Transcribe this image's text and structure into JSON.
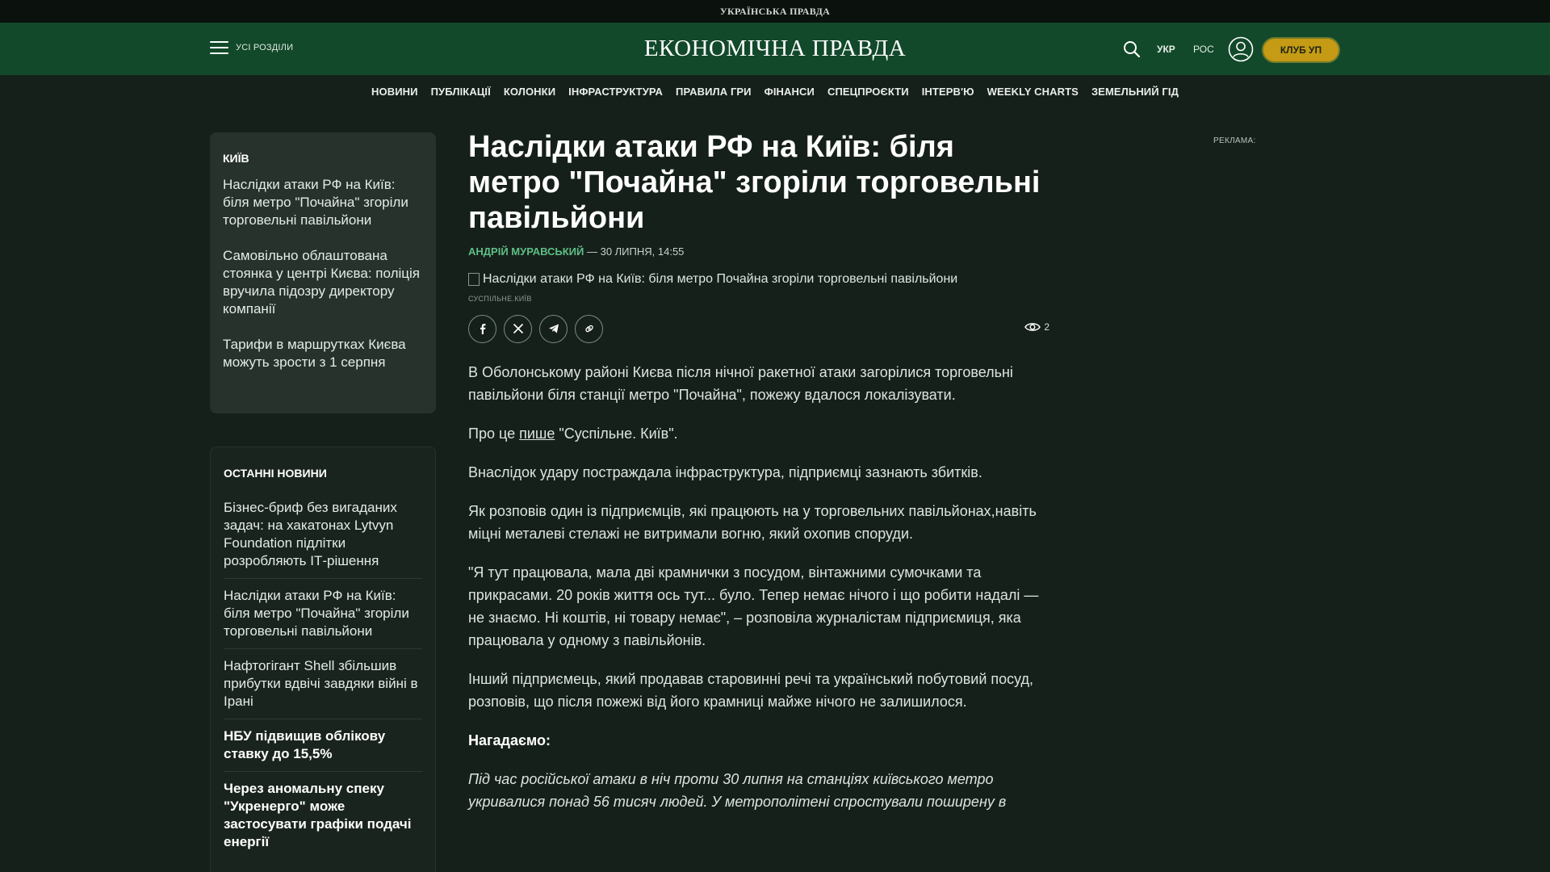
{
  "topstrip": {
    "brand": "УКРАЇНСЬКА ПРАВДА"
  },
  "header": {
    "menu_label": "УСІ РОЗДІЛИ",
    "logo": "ЕКОНОМІЧНА ПРАВДА",
    "lang_ukr": "УКР",
    "lang_ros": "РОС",
    "club_label": "КЛУБ УП"
  },
  "nav": {
    "items": [
      "НОВИНИ",
      "ПУБЛІКАЦІЇ",
      "КОЛОНКИ",
      "ІНФРАСТРУКТУРА",
      "ПРАВИЛА ГРИ",
      "ФІНАНСИ",
      "СПЕЦПРОЄКТИ",
      "ІНТЕРВ'Ю",
      "WEEKLY CHARTS",
      "ЗЕМЕЛЬНИЙ ГІД"
    ]
  },
  "kyiv": {
    "title": "КИЇВ",
    "items": [
      "Наслідки атаки РФ на Київ: біля метро \"Почайна\" згоріли торговельні павільйони",
      "Самовільно облаштована стоянка у центрі Києва: поліція вручила підозру директору компанії",
      "Тарифи в маршрутках Києва можуть зрости з 1 серпня"
    ]
  },
  "latest": {
    "title": "ОСТАННІ НОВИНИ",
    "items": [
      "Бізнес-бриф без вигаданих задач: на хакатонах Lytvyn Foundation підлітки розробляють ІТ-рішення",
      "Наслідки атаки РФ на Київ: біля метро \"Почайна\" згоріли торговельні павільйони",
      "Нафтогігант Shell збільшив прибутки вдвічі завдяки війні в Ірані",
      "НБУ підвищив облікову ставку до 15,5%",
      "Через аномальну спеку \"Укренерго\" може застосувати графіки подачі енергії"
    ]
  },
  "article": {
    "headline": "Наслідки атаки РФ на Київ: біля метро \"Почайна\" згоріли торговельні павільйони",
    "author": "АНДРІЙ МУРАВСЬКИЙ",
    "date": " — 30 ЛИПНЯ, 14:55",
    "image_alt": "Наслідки атаки РФ на Київ: біля метро Почайна згоріли торговельні павільйони",
    "image_credit": "СУСПІЛЬНЕ.КИЇВ",
    "views": "2",
    "p1": "В Оболонському районі Києва після нічної ракетної атаки загорілися торговельні павільйони біля станції метро \"Почайна\", пожежу вдалося локалізувати.",
    "p2_before": "Про це ",
    "p2_link": "пише",
    "p2_after": " \"Суспільне. Київ\".",
    "p3": "Внаслідок удару постраждала інфраструктура, підприємці зазнають збитків.",
    "p4": "Як розповів один із підприємців, які працюють на у торговельних павільйонах,навіть міцні металеві стелажі не витримали вогню, який охопив споруди.",
    "p5": "\"Я тут працювала, мала дві крамнички з посудом, вінтажними сумочками та прикрасами. 20 років життя ось тут... було. Тепер немає нічого і що робити надалі — не знаємо. Ні коштів, ні товару немає\", – розповіла журналістам підприємиця, яка працювала у одному з павільйонів.",
    "p6": "Інший підприємець, який продавав старовинні речі та український побутовий посуд, розповів, що після пожежі від його крамниці майже нічого не залишилося.",
    "reminder": "Нагадаємо:",
    "p7": "Під час російської атаки в ніч проти 30 липня на станціях київського метро укривалися понад 56 тисяч людей. У метрополітені спростували поширену в"
  },
  "ad": {
    "label": "РЕКЛАМА:"
  },
  "colors": {
    "header_bg": "#12492a",
    "page_bg": "#16201a",
    "accent": "#5dbf86",
    "club": "#c59a14"
  }
}
